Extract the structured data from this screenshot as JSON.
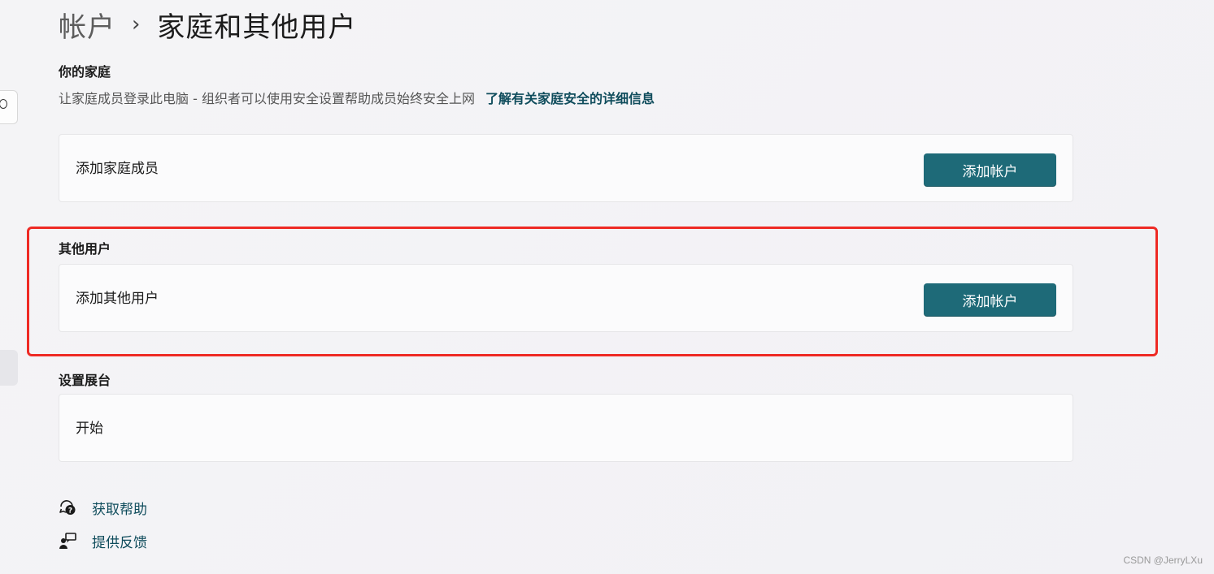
{
  "breadcrumb": {
    "parent": "帐户",
    "separator": "›",
    "current": "家庭和其他用户"
  },
  "family": {
    "title": "你的家庭",
    "description": "让家庭成员登录此电脑 - 组织者可以使用安全设置帮助成员始终安全上网",
    "link": "了解有关家庭安全的详细信息",
    "card_label": "添加家庭成员",
    "button_label": "添加帐户"
  },
  "other_users": {
    "title": "其他用户",
    "card_label": "添加其他用户",
    "button_label": "添加帐户"
  },
  "kiosk": {
    "title": "设置展台",
    "card_label": "开始"
  },
  "help": {
    "get_help": "获取帮助",
    "feedback": "提供反馈"
  },
  "watermark": "CSDN @JerryLXu",
  "colors": {
    "accent": "#1e6a78",
    "link": "#0f4c5c",
    "highlight": "#ee2a24"
  },
  "icons": {
    "get_help": "help-chat-icon",
    "feedback": "feedback-icon",
    "sidebar_search": "search-icon"
  }
}
